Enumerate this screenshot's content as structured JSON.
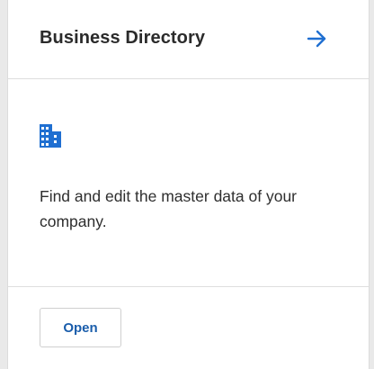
{
  "card": {
    "title": "Business Directory",
    "header_icon": "arrow-right-icon",
    "body_icon": "building-icon",
    "description": "Find and edit the master data of your company.",
    "open_label": "Open"
  },
  "colors": {
    "accent": "#1f6fd1",
    "title": "#2b2b2b",
    "text": "#2e2e2e",
    "button_text": "#1a5dab"
  }
}
